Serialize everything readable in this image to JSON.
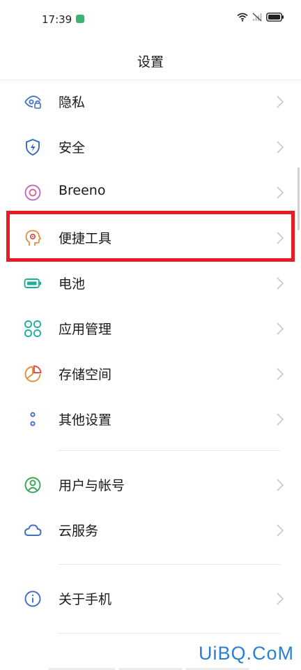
{
  "status_bar": {
    "time": "17:39",
    "icons": [
      "app-notification-icon",
      "wifi-icon",
      "no-signal-icon",
      "battery-icon"
    ]
  },
  "header": {
    "title": "设置"
  },
  "settings": [
    {
      "label": "隐私",
      "icon": "privacy-eye-lock-icon",
      "color": "#3d6fc7"
    },
    {
      "label": "安全",
      "icon": "shield-bolt-icon",
      "color": "#2e62c7"
    },
    {
      "label": "Breeno",
      "icon": "breeno-ring-icon",
      "color": "#c06ac8"
    },
    {
      "label": "便捷工具",
      "icon": "head-gear-icon",
      "color": "#e0903a"
    },
    {
      "label": "电池",
      "icon": "battery-icon",
      "color": "#1fae9c"
    },
    {
      "label": "应用管理",
      "icon": "apps-grid-icon",
      "color": "#1fae9c"
    },
    {
      "label": "存储空间",
      "icon": "pie-chart-icon",
      "color": "#e0903a"
    },
    {
      "label": "其他设置",
      "icon": "dots-icon",
      "color": "#3d6fc7"
    },
    {
      "label": "用户与帐号",
      "icon": "user-icon",
      "color": "#3aa655"
    },
    {
      "label": "云服务",
      "icon": "cloud-icon",
      "color": "#3d6fc7"
    },
    {
      "label": "关于手机",
      "icon": "info-icon",
      "color": "#3d6fc7"
    }
  ],
  "highlighted_item": "便捷工具",
  "watermark": "UiBQ.CoM"
}
